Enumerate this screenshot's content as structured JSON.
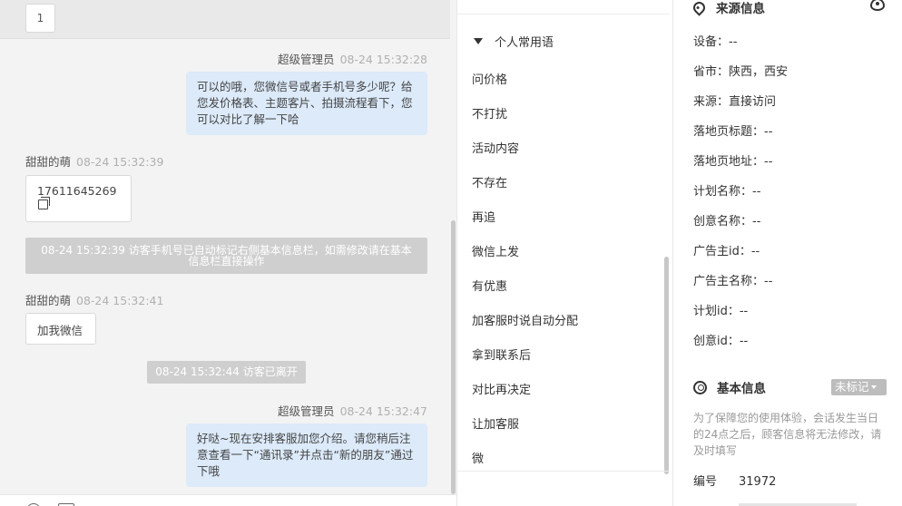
{
  "chat": {
    "top_card_value": "1",
    "messages": [
      {
        "sender": "超级管理员",
        "time": "08-24 15:32:28",
        "text": "可以的哦，您微信号或者手机号多少呢？给您发价格表、主题客片、拍摄流程看下，您可以对比了解一下哈"
      },
      {
        "sender": "甜甜的萌",
        "time": "08-24 15:32:39",
        "text": "17611645269"
      },
      {
        "system": "08-24 15:32:39 访客手机号已自动标记右侧基本信息栏，如需修改请在基本信息栏直接操作"
      },
      {
        "sender": "甜甜的萌",
        "time": "08-24 15:32:41",
        "text": "加我微信"
      },
      {
        "system": "08-24 15:32:44 访客已离开"
      },
      {
        "sender": "超级管理员",
        "time": "08-24 15:32:47",
        "text": "好哒~现在安排客服加您介绍。请您稍后注意查看一下“通讯录”并点击“新的朋友”通过下哦"
      }
    ]
  },
  "phrases": {
    "header": "个人常用语",
    "items": [
      "问价格",
      "不打扰",
      "活动内容",
      "不存在",
      "再追",
      "微信上发",
      "有优惠",
      "加客服时说自动分配",
      "拿到联系后",
      "对比再决定",
      "让加客服",
      "微"
    ]
  },
  "info": {
    "source_title": "来源信息",
    "source_rows": [
      "设备：--",
      "省市：陕西，西安",
      "来源：直接访问",
      "落地页标题：--",
      "落地页地址：--",
      "计划名称：--",
      "创意名称：--",
      "广告主id：--",
      "广告主名称：--",
      "计划id：--",
      "创意id：--"
    ],
    "basic_title": "基本信息",
    "tag_label": "未标记",
    "notice": "为了保障您的使用体验，会话发生当日的24点之后，顾客信息将无法修改，请及时填写",
    "id_label": "编号",
    "id_value": "31972"
  }
}
